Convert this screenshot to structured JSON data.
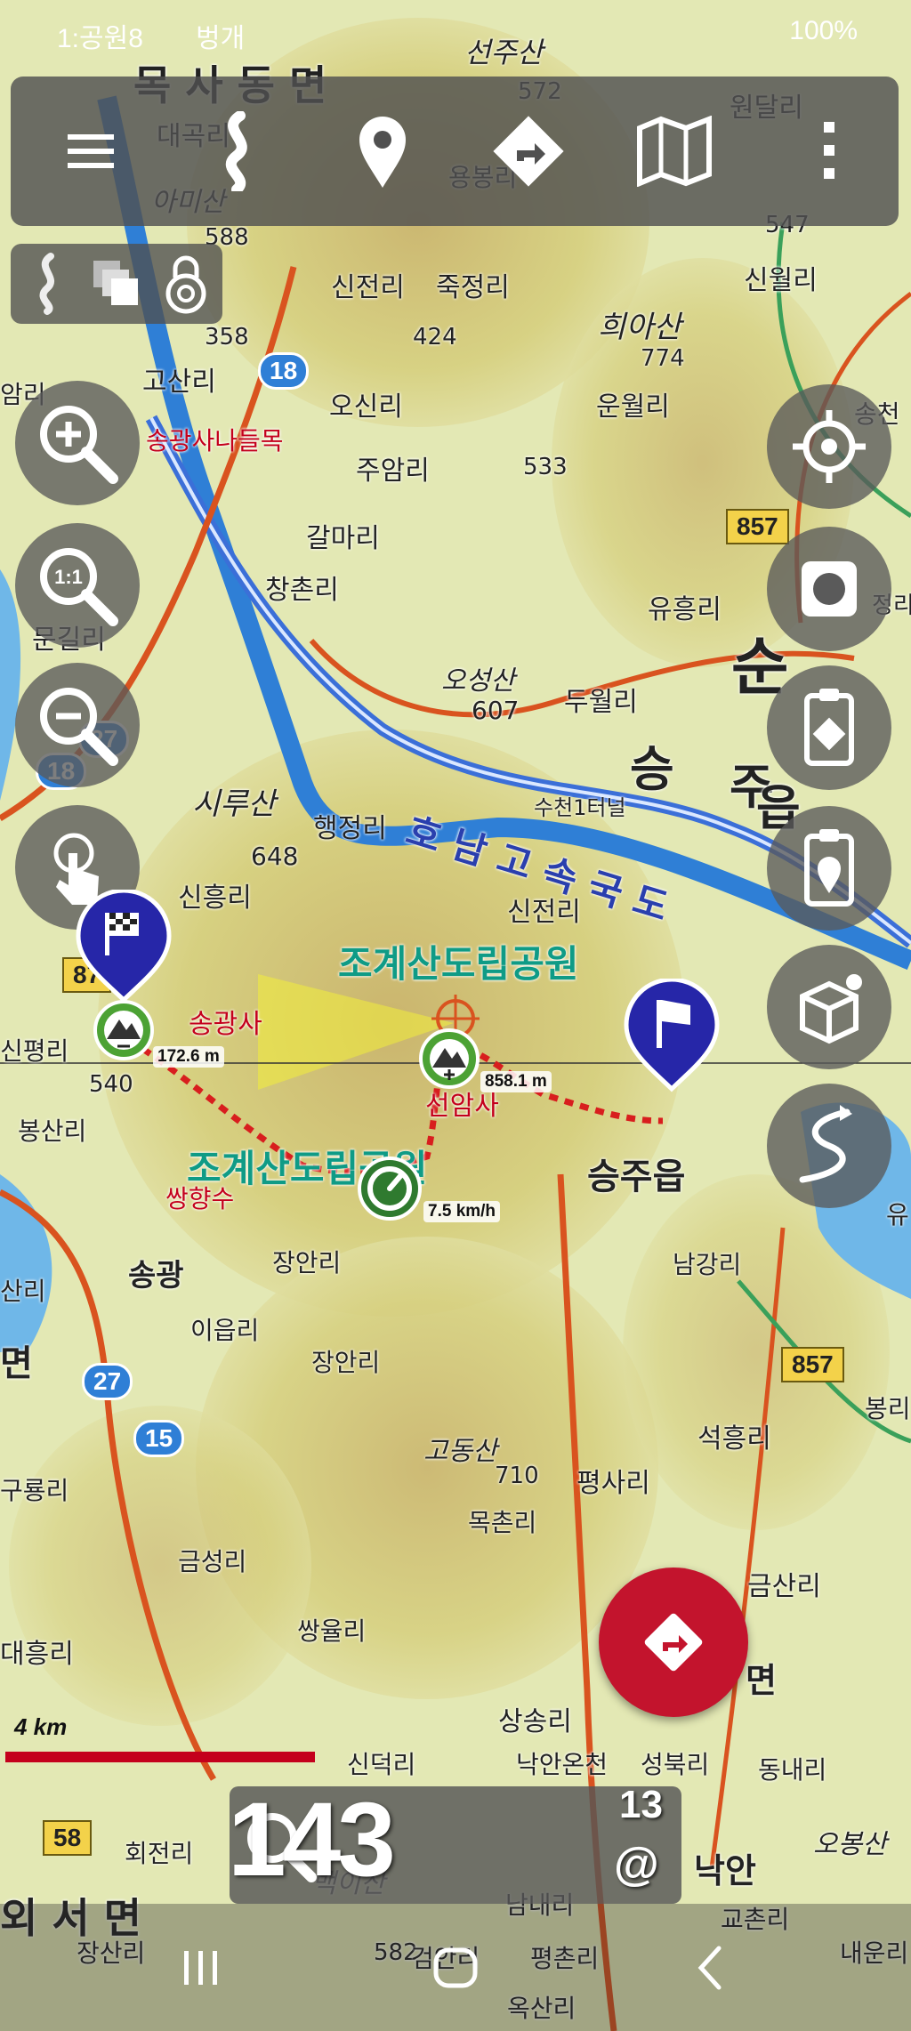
{
  "status_bar": {
    "time": "1:공원8",
    "carrier": "벙개",
    "battery": "100%"
  },
  "toolbar": {
    "items": [
      {
        "name": "menu-icon"
      },
      {
        "name": "route-icon"
      },
      {
        "name": "poi-pin-icon"
      },
      {
        "name": "directions-icon"
      },
      {
        "name": "map-layers-icon"
      },
      {
        "name": "more-vert-icon"
      }
    ]
  },
  "map": {
    "colors": {
      "river": "#2f7fd6",
      "road": "#d9531f",
      "expressway": "#3b6fd8",
      "track": "#d81e1e",
      "green_label": "#0f9b86",
      "accent": "#c3142d"
    },
    "place_names": [
      {
        "text": "목 사 동 면"
      },
      {
        "text": "대곡리"
      },
      {
        "text": "아미산"
      },
      {
        "text": "588"
      },
      {
        "text": "신전리"
      },
      {
        "text": "죽정리"
      },
      {
        "text": "희아산"
      },
      {
        "text": "774"
      },
      {
        "text": "신월리"
      },
      {
        "text": "용봉리"
      },
      {
        "text": "선주산"
      },
      {
        "text": "원달리"
      },
      {
        "text": "572"
      },
      {
        "text": "547"
      },
      {
        "text": "고산리"
      },
      {
        "text": "358"
      },
      {
        "text": "424"
      },
      {
        "text": "오신리"
      },
      {
        "text": "운월리"
      },
      {
        "text": "송광사나들목"
      },
      {
        "text": "주암리"
      },
      {
        "text": "533"
      },
      {
        "text": "갈마리"
      },
      {
        "text": "창촌리"
      },
      {
        "text": "유흥리"
      },
      {
        "text": "문길리"
      },
      {
        "text": "오성산"
      },
      {
        "text": "두월리"
      },
      {
        "text": "607"
      },
      {
        "text": "순"
      },
      {
        "text": "승"
      },
      {
        "text": "주"
      },
      {
        "text": "읍"
      },
      {
        "text": "시루산"
      },
      {
        "text": "행정리"
      },
      {
        "text": "648"
      },
      {
        "text": "수천1터널"
      },
      {
        "text": "신흥리"
      },
      {
        "text": "신전리"
      },
      {
        "text": "호 남 고 속 국 도"
      },
      {
        "text": "조계산도립공원"
      },
      {
        "text": "송광사"
      },
      {
        "text": "신평리"
      },
      {
        "text": "540"
      },
      {
        "text": "봉산리"
      },
      {
        "text": "선암사"
      },
      {
        "text": "조계산도립공원"
      },
      {
        "text": "쌍향수"
      },
      {
        "text": "승주읍"
      },
      {
        "text": "송광"
      },
      {
        "text": "장안리"
      },
      {
        "text": "이읍리"
      },
      {
        "text": "남강리"
      },
      {
        "text": "장안리"
      },
      {
        "text": "고동산"
      },
      {
        "text": "710"
      },
      {
        "text": "평사리"
      },
      {
        "text": "석흥리"
      },
      {
        "text": "구룡리"
      },
      {
        "text": "금성리"
      },
      {
        "text": "목촌리"
      },
      {
        "text": "금산리"
      },
      {
        "text": "쌍율리"
      },
      {
        "text": "대흥리"
      },
      {
        "text": "면"
      },
      {
        "text": "상송리"
      },
      {
        "text": "신덕리"
      },
      {
        "text": "낙안온천"
      },
      {
        "text": "성북리"
      },
      {
        "text": "동내리"
      },
      {
        "text": "회전리"
      },
      {
        "text": "외 서 면"
      },
      {
        "text": "백이산"
      },
      {
        "text": "낙안"
      },
      {
        "text": "오봉산"
      },
      {
        "text": "장산리"
      },
      {
        "text": "582"
      },
      {
        "text": "검안리"
      },
      {
        "text": "평촌리"
      },
      {
        "text": "교촌리"
      },
      {
        "text": "내운리"
      },
      {
        "text": "남내리"
      },
      {
        "text": "옥산리"
      },
      {
        "text": "송천"
      },
      {
        "text": "정리"
      },
      {
        "text": "유"
      },
      {
        "text": "봉리"
      },
      {
        "text": "면"
      },
      {
        "text": "산리"
      },
      {
        "text": "리"
      },
      {
        "text": "암리"
      }
    ],
    "road_shields": [
      {
        "text": "18"
      },
      {
        "text": "857"
      },
      {
        "text": "87"
      },
      {
        "text": "27"
      },
      {
        "text": "15"
      },
      {
        "text": "857"
      },
      {
        "text": "58"
      },
      {
        "text": "18"
      },
      {
        "text": "27"
      }
    ]
  },
  "track": {
    "distance_left": "172.6 m",
    "distance_right": "858.1 m",
    "speed": "7.5 km/h"
  },
  "scale": {
    "label": "4 km"
  },
  "speed_panel": {
    "value": "143",
    "sup": "13",
    "unit_symbol": "@"
  },
  "right_controls": [
    {
      "name": "gps-crosshair-icon"
    },
    {
      "name": "record-stop-icon"
    },
    {
      "name": "clipboard-route-icon"
    },
    {
      "name": "clipboard-pin-icon"
    },
    {
      "name": "3d-box-icon"
    },
    {
      "name": "winding-road-icon"
    }
  ],
  "left_controls": [
    {
      "name": "zoom-in-icon"
    },
    {
      "name": "zoom-1to1-icon"
    },
    {
      "name": "zoom-out-icon"
    },
    {
      "name": "touch-gesture-icon"
    }
  ],
  "system_nav": [
    {
      "name": "recent-apps-icon"
    },
    {
      "name": "home-icon"
    },
    {
      "name": "back-icon"
    }
  ]
}
